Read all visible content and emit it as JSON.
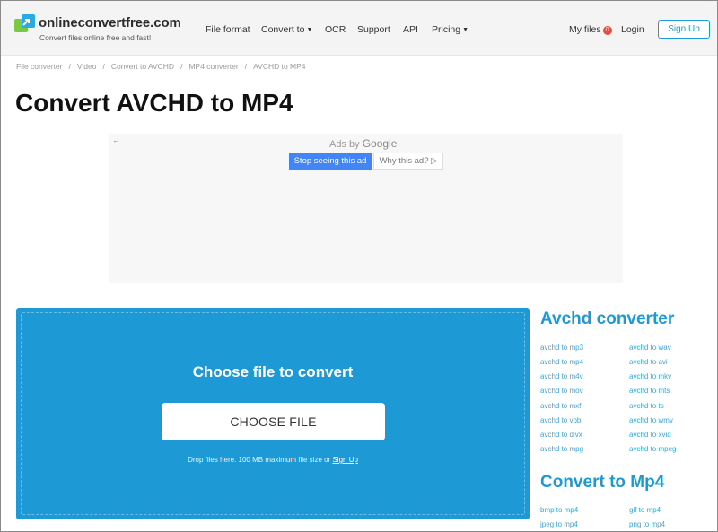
{
  "header": {
    "site_name": "onlineconvertfree.com",
    "tagline": "Convert files online free and fast!",
    "nav": [
      {
        "label": "File format",
        "caret": false
      },
      {
        "label": "Convert to",
        "caret": true
      },
      {
        "label": "OCR",
        "caret": false
      },
      {
        "label": "Support",
        "caret": false
      },
      {
        "label": "API",
        "caret": false
      },
      {
        "label": "Pricing",
        "caret": true
      }
    ],
    "my_files_label": "My files",
    "my_files_count": "0",
    "login_label": "Login",
    "signup_label": "Sign Up"
  },
  "breadcrumb": [
    "File converter",
    "Video",
    "Convert to AVCHD",
    "MP4 converter",
    "AVCHD to MP4"
  ],
  "page_title": "Convert AVCHD to MP4",
  "ad": {
    "back_glyph": "←",
    "ads_by": "Ads by",
    "google": "Google",
    "stop_label": "Stop seeing this ad",
    "why_label": "Why this ad? ▷"
  },
  "converter": {
    "title": "Choose file to convert",
    "button_label": "CHOOSE FILE",
    "note_prefix": "Drop files here. 100 MB maximum file size or ",
    "note_link": "Sign Up"
  },
  "sidebar": {
    "section1_title": "Avchd converter",
    "section1_links": [
      "avchd to mp3",
      "avchd to wav",
      "avchd to mp4",
      "avchd to avi",
      "avchd to m4v",
      "avchd to mkv",
      "avchd to mov",
      "avchd to mts",
      "avchd to mxf",
      "avchd to ts",
      "avchd to vob",
      "avchd to wmv",
      "avchd to divx",
      "avchd to xvid",
      "avchd to mpg",
      "avchd to mpeg"
    ],
    "section2_title": "Convert to Mp4",
    "section2_links": [
      "bmp to mp4",
      "gif to mp4",
      "jpeg to mp4",
      "png to mp4"
    ]
  },
  "colors": {
    "accent": "#1d9ad6",
    "header_bg": "#f4f4f5",
    "ad_button": "#4285f4",
    "badge": "#e74c3c"
  }
}
